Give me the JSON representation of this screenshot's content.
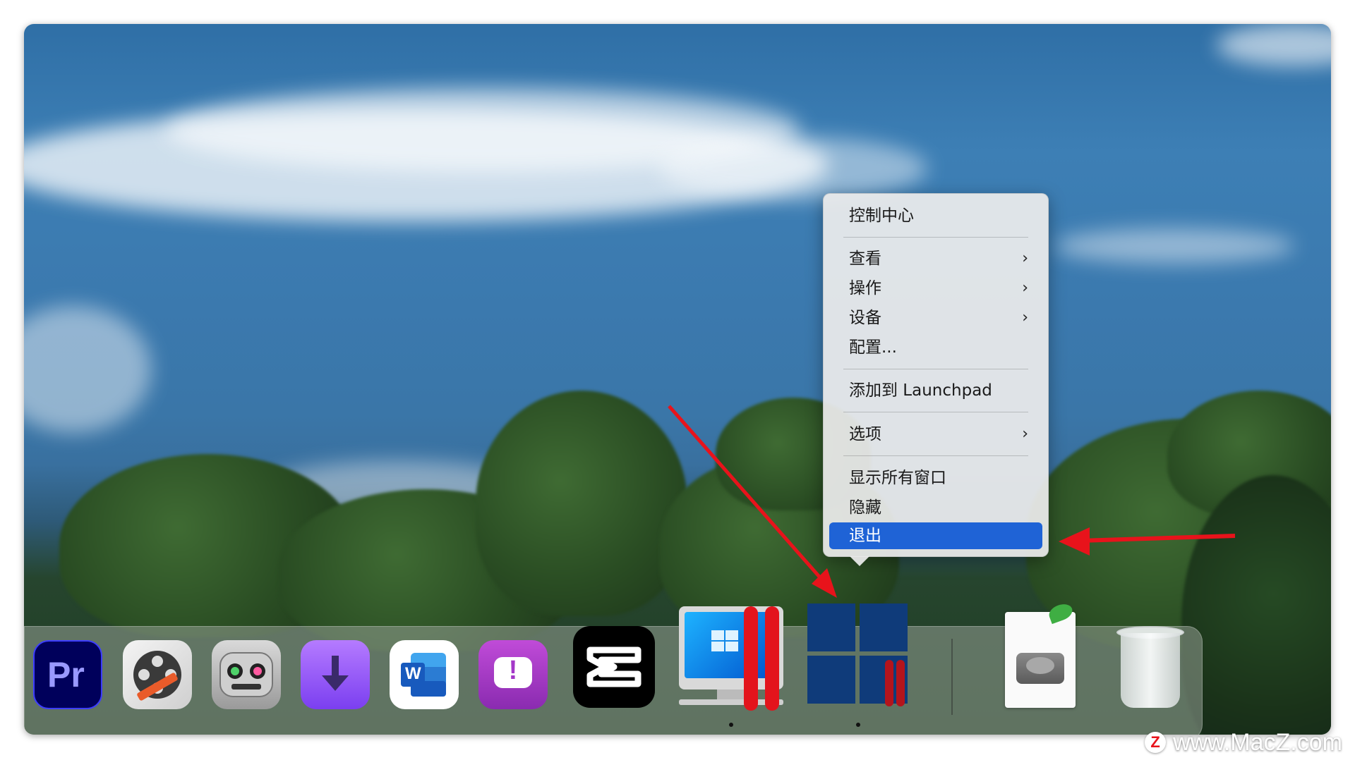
{
  "menu": {
    "items": [
      {
        "label": "控制中心",
        "submenu": false
      },
      {
        "label": "查看",
        "submenu": true
      },
      {
        "label": "操作",
        "submenu": true
      },
      {
        "label": "设备",
        "submenu": true
      },
      {
        "label": "配置...",
        "submenu": false
      },
      {
        "label": "添加到 Launchpad",
        "submenu": false
      },
      {
        "label": "选项",
        "submenu": true
      },
      {
        "label": "显示所有窗口",
        "submenu": false
      },
      {
        "label": "隐藏",
        "submenu": false
      },
      {
        "label": "退出",
        "submenu": false,
        "selected": true
      }
    ],
    "chevron": "›",
    "highlight_color": "#1f63d6"
  },
  "dock": {
    "apps": [
      {
        "name": "premiere-pro-icon",
        "text": "Pr"
      },
      {
        "name": "film-editor-icon"
      },
      {
        "name": "voice-robot-icon"
      },
      {
        "name": "downloader-icon"
      },
      {
        "name": "word-icon",
        "text": "W"
      },
      {
        "name": "feedback-icon",
        "text": "!"
      },
      {
        "name": "capcut-icon"
      },
      {
        "name": "parallels-desktop-icon"
      },
      {
        "name": "windows-11-icon"
      },
      {
        "name": "disk-image-icon"
      },
      {
        "name": "trash-icon"
      }
    ]
  },
  "annotation_color": "#e8131b",
  "watermark": {
    "z": "Z",
    "text": "www.MacZ.com"
  }
}
